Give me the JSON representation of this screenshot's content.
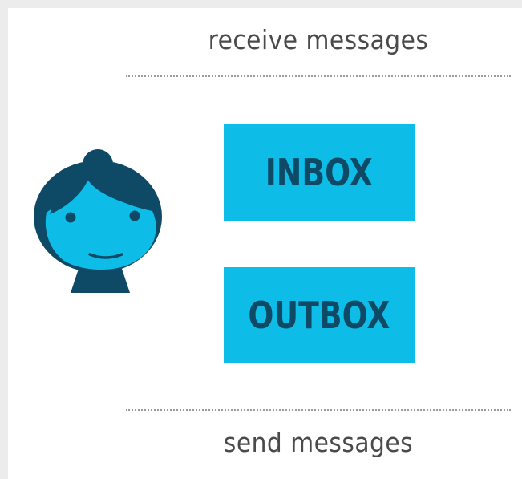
{
  "captions": {
    "receive": "receive messages",
    "send": "send messages"
  },
  "boxes": {
    "inbox": "INBOX",
    "outbox": "OUTBOX"
  },
  "colors": {
    "box_fill": "#0dbde8",
    "box_text": "#0e4a66",
    "avatar_dark": "#0e4a66",
    "avatar_face": "#0dbde8"
  },
  "icons": {
    "avatar": "person-avatar-icon"
  }
}
